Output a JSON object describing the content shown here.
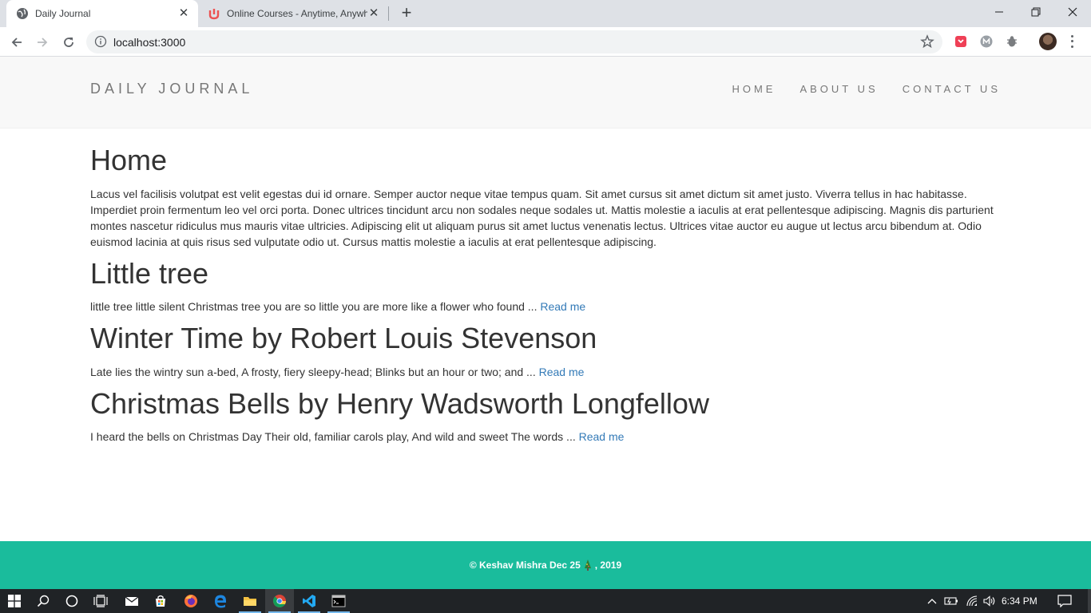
{
  "browser": {
    "tabs": [
      {
        "title": "Daily Journal",
        "active": true
      },
      {
        "title": "Online Courses - Anytime, Anywhere",
        "active": false
      }
    ],
    "address": "localhost:3000"
  },
  "site": {
    "brand": "DAILY JOURNAL",
    "nav": [
      "HOME",
      "ABOUT US",
      "CONTACT US"
    ]
  },
  "home": {
    "heading": "Home",
    "text": "Lacus vel facilisis volutpat est velit egestas dui id ornare. Semper auctor neque vitae tempus quam. Sit amet cursus sit amet dictum sit amet justo. Viverra tellus in hac habitasse. Imperdiet proin fermentum leo vel orci porta. Donec ultrices tincidunt arcu non sodales neque sodales ut. Mattis molestie a iaculis at erat pellentesque adipiscing. Magnis dis parturient montes nascetur ridiculus mus mauris vitae ultricies. Adipiscing elit ut aliquam purus sit amet luctus venenatis lectus. Ultrices vitae auctor eu augue ut lectus arcu bibendum at. Odio euismod lacinia at quis risus sed vulputate odio ut. Cursus mattis molestie a iaculis at erat pellentesque adipiscing."
  },
  "posts": [
    {
      "title": "Little tree",
      "excerpt": "little tree little silent Christmas tree you are so little you are more like a flower who found ... ",
      "link": "Read me"
    },
    {
      "title": "Winter Time by Robert Louis Stevenson",
      "excerpt": "Late lies the wintry sun a-bed, A frosty, fiery sleepy-head; Blinks but an hour or two; and ... ",
      "link": "Read me"
    },
    {
      "title": "Christmas Bells by Henry Wadsworth Longfellow",
      "excerpt": "I heard the bells on Christmas Day Their old, familiar carols play, And wild and sweet The words ... ",
      "link": "Read me"
    }
  ],
  "footer": {
    "before": "© Keshav Mishra Dec 25",
    "after": ", 2019"
  },
  "taskbar": {
    "time": "6:34 PM"
  },
  "colors": {
    "footer_bg": "#1abc9c",
    "link": "#337ab7",
    "navbar_bg": "#f8f8f8"
  }
}
